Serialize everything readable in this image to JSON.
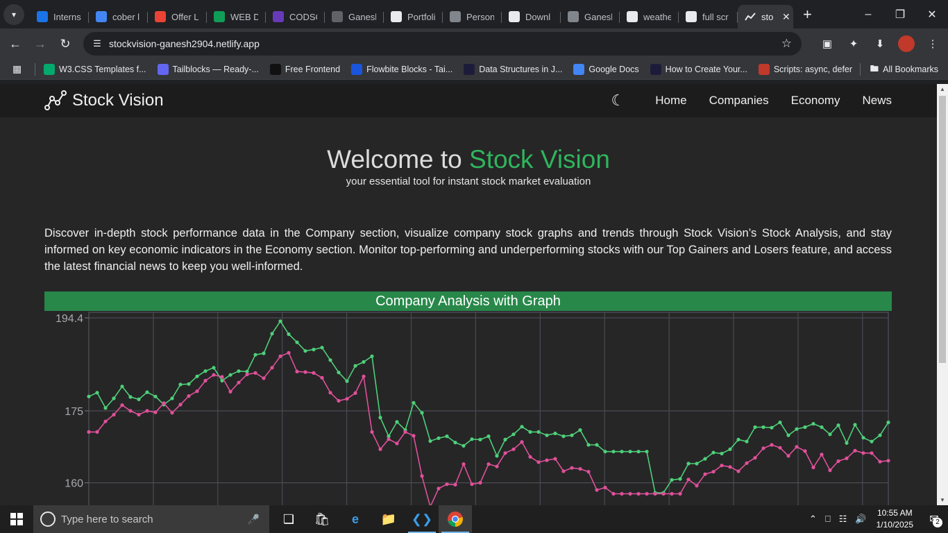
{
  "browser": {
    "tabs": [
      {
        "label": "Interns",
        "icon": "IS",
        "color": "#1a73e8"
      },
      {
        "label": "cober l",
        "icon": "doc",
        "color": "#4285f4"
      },
      {
        "label": "Offer L",
        "icon": "M",
        "color": "#ea4335"
      },
      {
        "label": "WEB D",
        "icon": "drive",
        "color": "#0f9d58"
      },
      {
        "label": "CODSC",
        "icon": "form",
        "color": "#673ab7"
      },
      {
        "label": "Ganesh",
        "icon": "spinner",
        "color": "#5f6368"
      },
      {
        "label": "Portfoli",
        "icon": "gpt",
        "color": "#e8eaed"
      },
      {
        "label": "Person",
        "icon": "globe",
        "color": "#80868b"
      },
      {
        "label": "Downl",
        "icon": "download",
        "color": "#e8eaed"
      },
      {
        "label": "Ganesh",
        "icon": "globe",
        "color": "#80868b"
      },
      {
        "label": "weathe",
        "icon": "G",
        "color": "#e8eaed"
      },
      {
        "label": "full scr",
        "icon": "G",
        "color": "#e8eaed"
      }
    ],
    "active_tab": {
      "label": "sto",
      "icon": "chart-line"
    },
    "url": "stockvision-ganesh2904.netlify.app",
    "bookmarks": [
      {
        "label": "W3.CSS Templates f...",
        "icon": "W",
        "color": "#04aa6d"
      },
      {
        "label": "Tailblocks — Ready-...",
        "icon": "T",
        "color": "#6366f1"
      },
      {
        "label": "Free Frontend",
        "icon": "F",
        "color": "#111111"
      },
      {
        "label": "Flowbite Blocks - Tai...",
        "icon": "F",
        "color": "#1a56db"
      },
      {
        "label": "Data Structures in J...",
        "icon": "A",
        "color": "#1c1c3a"
      },
      {
        "label": "Google Docs",
        "icon": "doc",
        "color": "#4285f4"
      },
      {
        "label": "How to Create Your...",
        "icon": "A",
        "color": "#1c1c3a"
      },
      {
        "label": "Scripts: async, defer",
        "icon": "J",
        "color": "#c0392b"
      }
    ],
    "all_bookmarks": "All Bookmarks"
  },
  "site": {
    "brand": "Stock Vision",
    "nav": [
      "Home",
      "Companies",
      "Economy",
      "News"
    ],
    "hero_prefix": "Welcome to ",
    "hero_accent": "Stock Vision",
    "tagline": "your essential tool for instant stock market evaluation",
    "intro": "Discover in-depth stock performance data in the Company section, visualize company stock graphs and trends through Stock Vision’s Stock Analysis, and stay informed on key economic indicators in the Economy section. Monitor top-performing and underperforming stocks with our Top Gainers and Losers feature, and access the latest financial news to keep you well-informed.",
    "section_title": "Company Analysis with Graph",
    "colors": {
      "accent": "#2fb55d",
      "bar": "#28884a",
      "series_high": "#4ed07a",
      "series_low": "#e0509a"
    }
  },
  "chart_data": {
    "type": "line",
    "ytick_labels": [
      "194.4",
      "175",
      "160"
    ],
    "yticks": [
      194.4,
      175,
      160
    ],
    "ylim": [
      156,
      195.5
    ],
    "grid": true,
    "series": [
      {
        "values": [
          178.0,
          178.8,
          175.6,
          177.6,
          180.1,
          177.9,
          177.4,
          178.9,
          178.0,
          176.3,
          177.6,
          180.5,
          180.6,
          182.2,
          183.3,
          184.0,
          181.3,
          182.5,
          183.3,
          183.2,
          186.7,
          187.0,
          191.1,
          193.7,
          191.0,
          189.3,
          187.5,
          187.8,
          188.2,
          185.6,
          183.0,
          181.2,
          184.4,
          185.2,
          186.4,
          173.6,
          169.7,
          172.7,
          171.0,
          176.7,
          174.6,
          168.7,
          169.3,
          169.7,
          168.4,
          167.7,
          169.1,
          169.0,
          169.7,
          165.6,
          169.0,
          170.1,
          171.7,
          170.6,
          170.6,
          169.9,
          170.3,
          169.7,
          169.9,
          171.0,
          167.9,
          167.9,
          166.5,
          166.5,
          166.5,
          166.5,
          166.5,
          166.5,
          157.9,
          157.9,
          160.6,
          160.8,
          164.0,
          164.0,
          165.0,
          166.3,
          166.1,
          167.0,
          169.0,
          168.6,
          171.6,
          171.6,
          171.5,
          172.6,
          169.9,
          171.2,
          171.6,
          172.3,
          171.6,
          170.1,
          172.0,
          168.3,
          172.1,
          169.4,
          168.6,
          169.9,
          172.6
        ],
        "color": "#4ed07a"
      },
      {
        "values": [
          170.6,
          170.6,
          172.8,
          174.2,
          176.2,
          175.0,
          174.2,
          175.0,
          174.7,
          176.6,
          174.6,
          176.3,
          178.1,
          179.1,
          181.3,
          182.5,
          182.1,
          179.0,
          180.9,
          182.6,
          182.9,
          181.8,
          184.0,
          186.4,
          187.1,
          183.2,
          183.1,
          182.9,
          181.9,
          178.8,
          177.1,
          177.5,
          178.7,
          182.2,
          170.6,
          167.0,
          169.1,
          168.2,
          170.6,
          169.8,
          161.4,
          155.0,
          158.8,
          159.7,
          159.6,
          163.9,
          159.7,
          160.0,
          163.9,
          163.4,
          166.2,
          167.0,
          168.5,
          165.4,
          164.3,
          164.7,
          165.0,
          162.4,
          163.1,
          162.9,
          162.3,
          158.5,
          159.0,
          157.7,
          157.7,
          157.7,
          157.7,
          157.7,
          157.7,
          157.7,
          157.7,
          157.7,
          160.7,
          159.4,
          161.8,
          162.3,
          163.6,
          163.3,
          162.4,
          164.1,
          165.2,
          167.2,
          167.9,
          167.3,
          165.6,
          167.5,
          166.6,
          163.2,
          165.9,
          162.6,
          164.5,
          165.1,
          166.7,
          166.2,
          166.2,
          164.4,
          164.6
        ],
        "color": "#e0509a"
      }
    ]
  },
  "taskbar": {
    "search_placeholder": "Type here to search",
    "time": "10:55 AM",
    "date": "1/10/2025",
    "notification_count": "2"
  }
}
